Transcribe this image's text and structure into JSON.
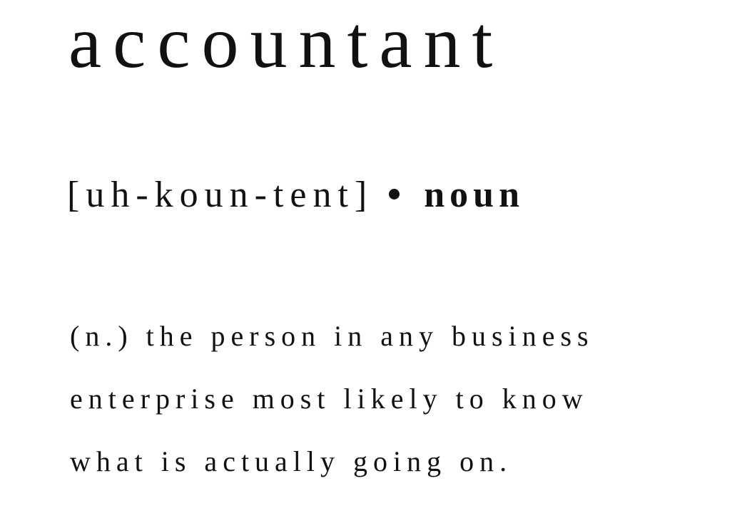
{
  "entry": {
    "headword": "accountant",
    "pronunciation": "[uh-koun-tent]",
    "part_of_speech": "noun",
    "definition_lines": [
      "(n.) the person in any business",
      "enterprise most likely to know",
      "what is actually going on."
    ]
  },
  "colors": {
    "background": "#ffffff",
    "text": "#111111"
  }
}
